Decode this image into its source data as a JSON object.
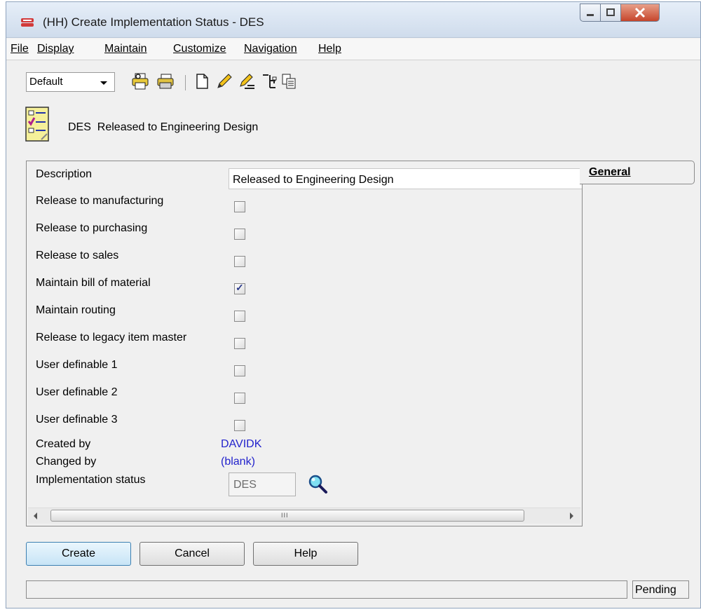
{
  "window": {
    "title": "(HH) Create Implementation Status - DES"
  },
  "menu": {
    "items": [
      {
        "label": "File"
      },
      {
        "label": "Display"
      },
      {
        "label": "Maintain"
      },
      {
        "label": "Customize"
      },
      {
        "label": "Navigation"
      },
      {
        "label": "Help"
      }
    ]
  },
  "toolbar": {
    "view_select": "Default",
    "icons": [
      "print-preview-icon",
      "print-icon",
      "new-document-icon",
      "edit-pencil-icon",
      "edit-lines-icon",
      "tree-structure-icon",
      "copy-icon"
    ]
  },
  "header": {
    "code": "DES",
    "description": "Released to Engineering Design"
  },
  "form": {
    "description_label": "Description",
    "description_value": "Released to Engineering Design",
    "checkboxes": [
      {
        "label": "Release to manufacturing",
        "checked": false
      },
      {
        "label": "Release to purchasing",
        "checked": false
      },
      {
        "label": "Release to sales",
        "checked": false
      },
      {
        "label": "Maintain bill of material",
        "checked": true
      },
      {
        "label": "Maintain routing",
        "checked": false
      },
      {
        "label": "Release to legacy item master",
        "checked": false
      },
      {
        "label": "User definable 1",
        "checked": false
      },
      {
        "label": "User definable 2",
        "checked": false
      },
      {
        "label": "User definable 3",
        "checked": false
      }
    ],
    "created_by_label": "Created by",
    "created_by_value": "DAVIDK",
    "changed_by_label": "Changed by",
    "changed_by_value": "(blank)",
    "impl_status_label": "Implementation status",
    "impl_status_value": "DES",
    "scroll_grip": "III"
  },
  "tabs": [
    {
      "label": "General",
      "active": true
    }
  ],
  "buttons": {
    "create": "Create",
    "cancel": "Cancel",
    "help": "Help"
  },
  "status": {
    "message": "",
    "state": "Pending"
  },
  "colors": {
    "link": "#2222cc",
    "checkmark": "#2b3a8a",
    "close_button": "#c6452b"
  }
}
